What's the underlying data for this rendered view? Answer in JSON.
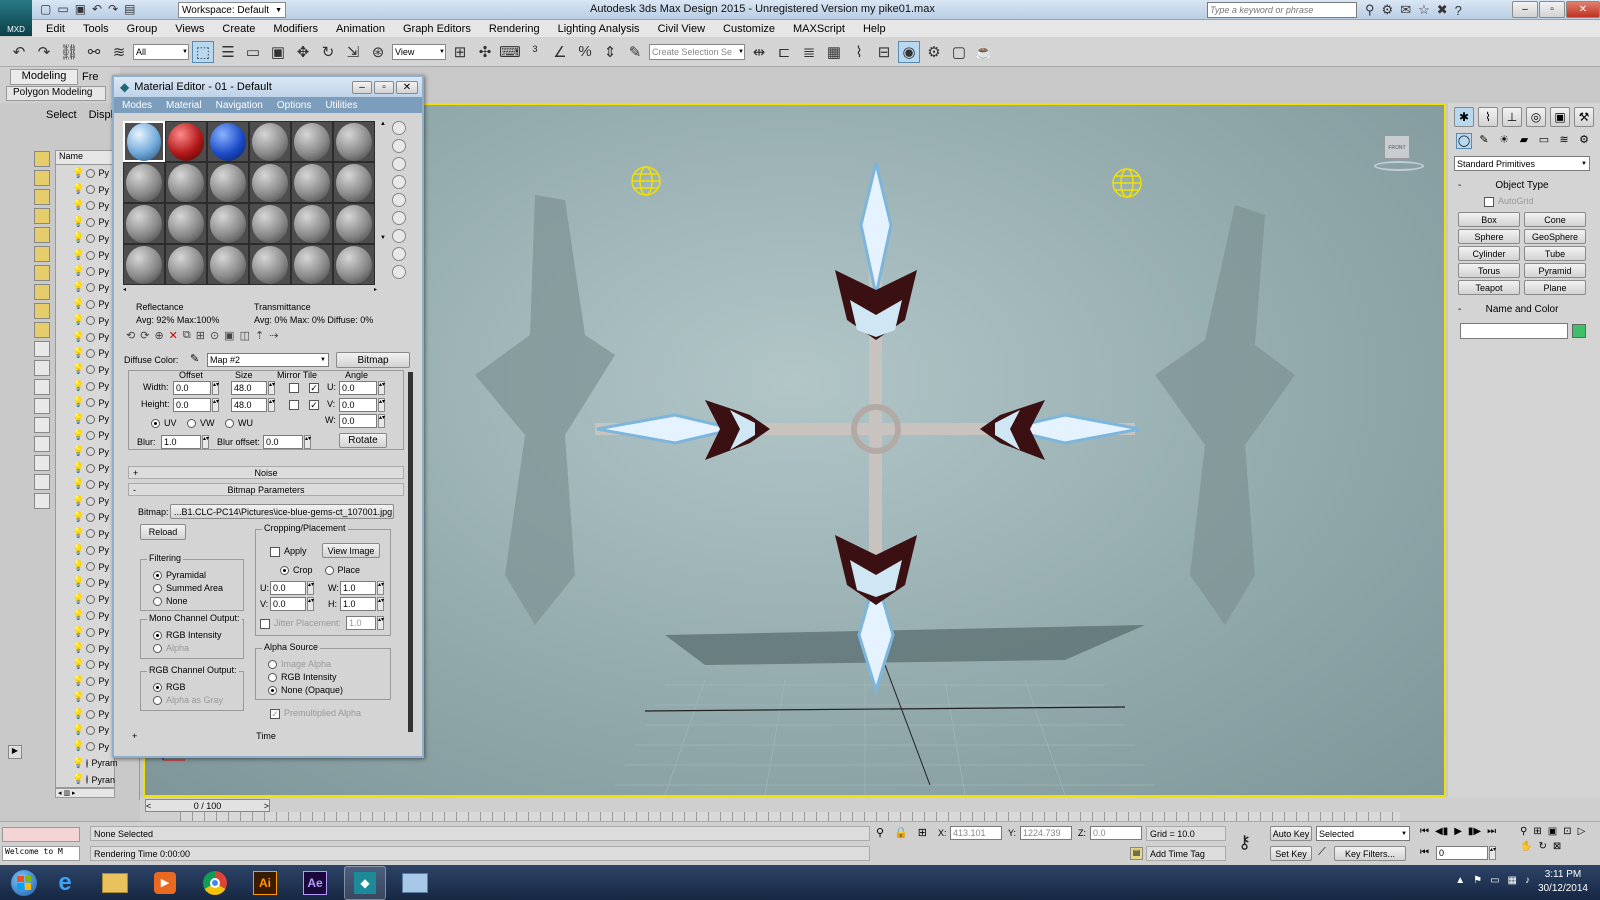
{
  "title_bar": {
    "workspace": "Workspace: Default",
    "title": "Autodesk 3ds Max Design 2015  -  Unregistered Version    my pike01.max",
    "search_placeholder": "Type a keyword or phrase",
    "logo": "MXD"
  },
  "menu": [
    "Edit",
    "Tools",
    "Group",
    "Views",
    "Create",
    "Modifiers",
    "Animation",
    "Graph Editors",
    "Rendering",
    "Lighting Analysis",
    "Civil View",
    "Customize",
    "MAXScript",
    "Help"
  ],
  "toolbar": {
    "filter": "All",
    "refcoord": "View",
    "selection_set_placeholder": "Create Selection Se"
  },
  "ribbon": {
    "tabs": [
      "Modeling",
      "Fre"
    ],
    "sub": "Polygon Modeling"
  },
  "scene_explorer": {
    "tabs": [
      "Select",
      "Displa"
    ],
    "column": "Name",
    "rows": [
      "Py",
      "Py",
      "Py",
      "Py",
      "Py",
      "Py",
      "Py",
      "Py",
      "Py",
      "Py",
      "Py",
      "Py",
      "Py",
      "Py",
      "Py",
      "Py",
      "Py",
      "Py",
      "Py",
      "Py",
      "Py",
      "Py",
      "Py",
      "Py",
      "Py",
      "Py",
      "Py",
      "Py",
      "Py",
      "Py",
      "Py",
      "Py",
      "Py",
      "Py",
      "Py",
      "Py",
      "Pyram",
      "Pyran"
    ]
  },
  "material_editor": {
    "title": "Material Editor - 01 - Default",
    "menu": [
      "Modes",
      "Material",
      "Navigation",
      "Options",
      "Utilities"
    ],
    "reflectance_label": "Reflectance",
    "reflectance_value": "Avg: 92% Max:100%",
    "transmittance_label": "Transmittance",
    "transmittance_value": "Avg:   0% Max:   0%  Diffuse:   0%",
    "diffuse_label": "Diffuse Color:",
    "map_name": "Map #2",
    "map_type": "Bitmap",
    "coords": {
      "offset": "Offset",
      "size": "Size",
      "mirror_tile": "Mirror Tile",
      "angle": "Angle",
      "width": "Width:",
      "height": "Height:",
      "w_off": "0.0",
      "h_off": "0.0",
      "w_size": "48.0",
      "h_size": "48.0",
      "u": "U:",
      "v": "V:",
      "w": "W:",
      "u_val": "0.0",
      "v_val": "0.0",
      "w_val": "0.0",
      "uv": "UV",
      "vw": "VW",
      "wu": "WU",
      "blur": "Blur:",
      "blur_val": "1.0",
      "blur_offset": "Blur offset:",
      "blur_offset_val": "0.0",
      "rotate": "Rotate"
    },
    "noise": "Noise",
    "bitmap_params": "Bitmap Parameters",
    "bitmap_label": "Bitmap:",
    "bitmap_path": "...B1.CLC-PC14\\Pictures\\ice-blue-gems-ct_107001.jpg",
    "reload": "Reload",
    "cropping": {
      "title": "Cropping/Placement",
      "apply": "Apply",
      "view_image": "View Image",
      "crop": "Crop",
      "place": "Place",
      "u": "U:",
      "v": "V:",
      "w": "W:",
      "h": "H:",
      "u_val": "0.0",
      "v_val": "0.0",
      "w_val": "1.0",
      "h_val": "1.0",
      "jitter": "Jitter Placement:",
      "jitter_val": "1.0"
    },
    "filtering": {
      "title": "Filtering",
      "opts": [
        "Pyramidal",
        "Summed Area",
        "None"
      ]
    },
    "mono": {
      "title": "Mono Channel Output:",
      "opts": [
        "RGB Intensity",
        "Alpha"
      ]
    },
    "rgb": {
      "title": "RGB Channel Output:",
      "opts": [
        "RGB",
        "Alpha as Gray"
      ]
    },
    "alpha": {
      "title": "Alpha Source",
      "opts": [
        "Image Alpha",
        "RGB Intensity",
        "None (Opaque)"
      ],
      "premult": "Premultiplied Alpha"
    },
    "time": "Time"
  },
  "viewport": {
    "viewcube": "FRONT"
  },
  "command_panel": {
    "dropdown": "Standard Primitives",
    "object_type": "Object Type",
    "autogrid": "AutoGrid",
    "buttons": [
      "Box",
      "Cone",
      "Sphere",
      "GeoSphere",
      "Cylinder",
      "Tube",
      "Torus",
      "Pyramid",
      "Teapot",
      "Plane"
    ],
    "name_color": "Name and Color",
    "swatch": "#3fbf6a"
  },
  "timeline": {
    "frame": "0 / 100"
  },
  "status": {
    "welcome": "Welcome to M",
    "selected": "None Selected",
    "render_time": "Rendering Time  0:00:00",
    "x_label": "X:",
    "x": "413.101",
    "y_label": "Y:",
    "y": "1224.739",
    "z_label": "Z:",
    "z": "0.0",
    "grid": "Grid = 10.0",
    "add_time_tag": "Add Time Tag",
    "auto_key": "Auto Key",
    "set_key": "Set Key",
    "selected_dd": "Selected",
    "key_filters": "Key Filters...",
    "frame_field": "0"
  },
  "taskbar": {
    "time": "3:11 PM",
    "date": "30/12/2014"
  },
  "colors": {
    "viewport_border": "#f2e000",
    "titlebar": "#c4d6ea",
    "taskbar": "#1c2f4e"
  }
}
